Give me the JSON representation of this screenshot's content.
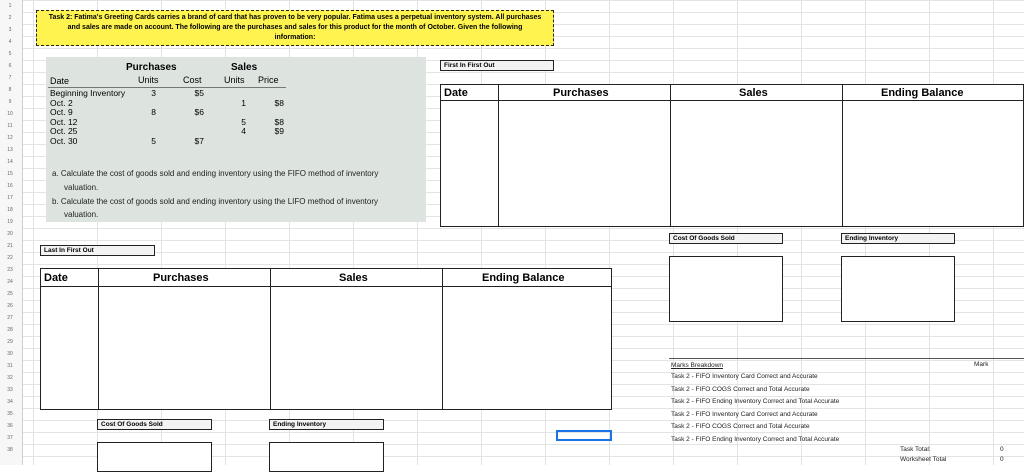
{
  "row_numbers": [
    "1",
    "2",
    "3",
    "4",
    "5",
    "6",
    "7",
    "8",
    "9",
    "10",
    "11",
    "12",
    "13",
    "14",
    "15",
    "16",
    "17",
    "18",
    "19",
    "20",
    "21",
    "22",
    "23",
    "24",
    "25",
    "26",
    "27",
    "28",
    "29",
    "30",
    "31",
    "32",
    "33",
    "34",
    "35",
    "36",
    "37",
    "38"
  ],
  "task": {
    "text": "Task 2: Fatima's Greeting Cards carries a brand of card that has proven to be very popular. Fatima uses a perpetual inventory system. All purchases and sales are made on account. The following are the purchases and sales for this product for the month of October. Given the following information:"
  },
  "data_panel": {
    "purchases_header": "Purchases",
    "sales_header": "Sales",
    "col_date": "Date",
    "col_units": "Units",
    "col_cost": "Cost",
    "col_sales_units": "Units",
    "col_price": "Price",
    "rows": [
      {
        "date": "Beginning Inventory",
        "p_units": "3",
        "p_cost": "$5",
        "s_units": "",
        "s_price": ""
      },
      {
        "date": "Oct. 2",
        "p_units": "",
        "p_cost": "",
        "s_units": "1",
        "s_price": "$8"
      },
      {
        "date": "Oct. 9",
        "p_units": "8",
        "p_cost": "$6",
        "s_units": "",
        "s_price": ""
      },
      {
        "date": "Oct. 12",
        "p_units": "",
        "p_cost": "",
        "s_units": "5",
        "s_price": "$8"
      },
      {
        "date": "Oct. 25",
        "p_units": "",
        "p_cost": "",
        "s_units": "4",
        "s_price": "$9"
      },
      {
        "date": "Oct. 30",
        "p_units": "5",
        "p_cost": "$7",
        "s_units": "",
        "s_price": ""
      }
    ],
    "question_a_1": "a. Calculate the cost of goods sold and ending inventory using the FIFO method of inventory",
    "question_a_2": "valuation.",
    "question_b_1": "b. Calculate the cost of goods sold and ending inventory using the LIFO method of inventory",
    "question_b_2": "valuation."
  },
  "fifo": {
    "label": "First In First Out",
    "headers": [
      "Date",
      "Purchases",
      "Sales",
      "Ending Balance"
    ],
    "cogs_label": "Cost Of Goods Sold",
    "ending_label": "Ending Inventory"
  },
  "lifo": {
    "label": "Last In First Out",
    "headers": [
      "Date",
      "Purchases",
      "Sales",
      "Ending Balance"
    ],
    "cogs_label": "Cost Of Goods Sold",
    "ending_label": "Ending Inventory"
  },
  "marks": {
    "title": "Marks Breakdown",
    "mark_header": "Mark",
    "items": [
      "Task 2 - FIFO Inventory Card Correct and Accurate",
      "Task 2 - FIFO COGS Correct and Total Accurate",
      "Task 2 - FIFO Ending Inventory Correct and Total Accurate",
      "Task 2 - FIFO Inventory Card Correct and Accurate",
      "Task 2 - FIFO COGS Correct and Total Accurate",
      "Task 2 - FIFO Ending Inventory Correct and Total Accurate"
    ],
    "task_total_label": "Task Total:",
    "task_total_value": "0",
    "worksheet_total_label": "Worksheet Total",
    "worksheet_total_value": "0"
  }
}
